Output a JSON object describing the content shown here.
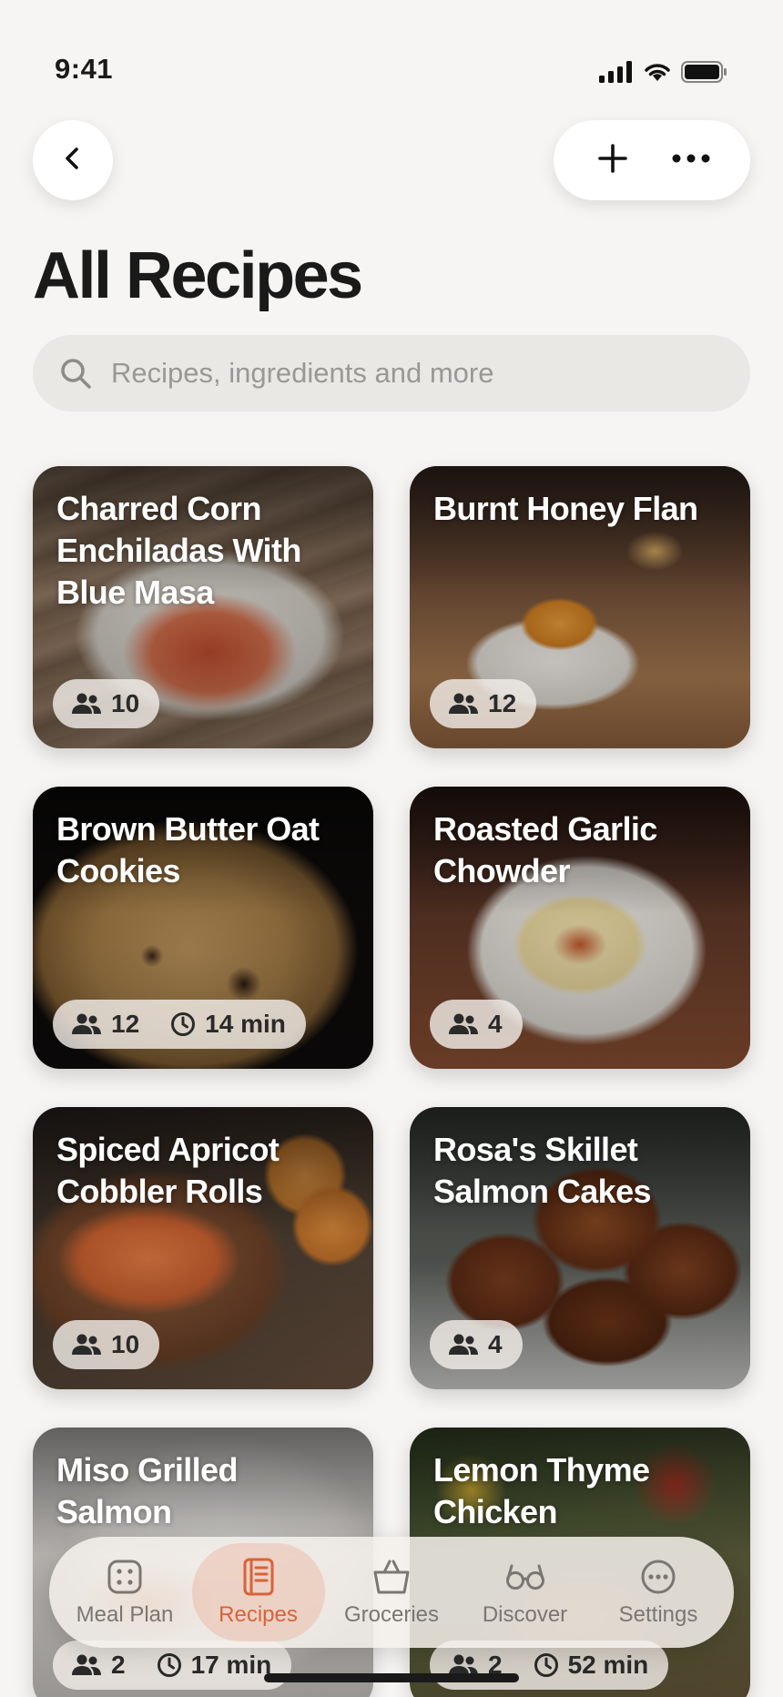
{
  "status_bar": {
    "time": "9:41"
  },
  "header": {
    "title": "All Recipes"
  },
  "search": {
    "placeholder": "Recipes, ingredients and more"
  },
  "recipes": [
    {
      "title": "Charred Corn Enchiladas With Blue Masa",
      "servings": "10"
    },
    {
      "title": "Burnt Honey Flan",
      "servings": "12"
    },
    {
      "title": "Brown Butter Oat Cookies",
      "servings": "12",
      "time": "14 min"
    },
    {
      "title": "Roasted Garlic Chowder",
      "servings": "4"
    },
    {
      "title": "Spiced Apricot Cobbler Rolls",
      "servings": "10"
    },
    {
      "title": "Rosa's Skillet Salmon Cakes",
      "servings": "4"
    },
    {
      "title": "Miso Grilled Salmon",
      "servings": "2",
      "time": "17 min"
    },
    {
      "title": "Lemon Thyme Chicken",
      "servings": "2",
      "time": "52 min"
    }
  ],
  "tabs": [
    {
      "label": "Meal Plan",
      "icon": "meal-plan-icon"
    },
    {
      "label": "Recipes",
      "icon": "recipes-icon",
      "active": true
    },
    {
      "label": "Groceries",
      "icon": "basket-icon"
    },
    {
      "label": "Discover",
      "icon": "glasses-icon"
    },
    {
      "label": "Settings",
      "icon": "ellipsis-circle-icon"
    }
  ],
  "colors": {
    "accent": "#d9623a",
    "background": "#f6f5f3"
  }
}
